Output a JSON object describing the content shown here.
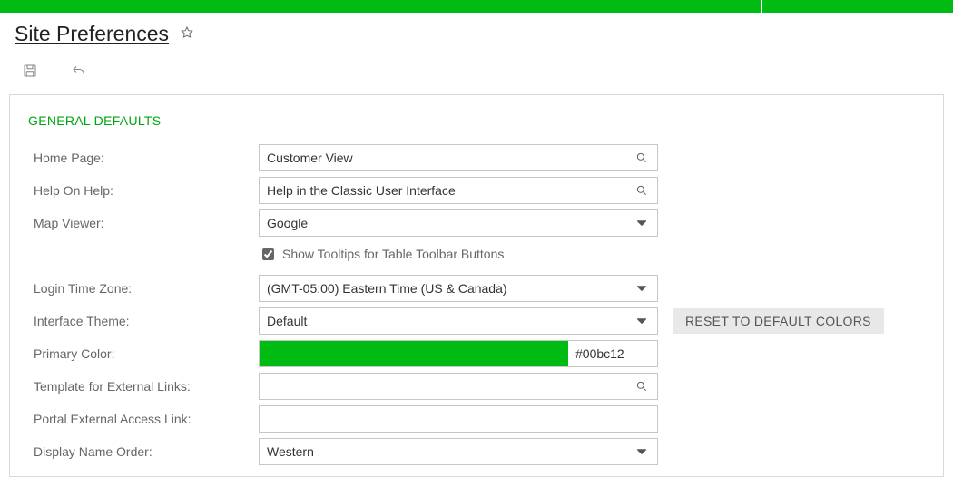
{
  "page": {
    "title": "Site Preferences"
  },
  "section": {
    "title": "GENERAL DEFAULTS"
  },
  "fields": {
    "home_page": {
      "label": "Home Page:",
      "value": "Customer View"
    },
    "help_on_help": {
      "label": "Help On Help:",
      "value": "Help in the Classic User Interface"
    },
    "map_viewer": {
      "label": "Map Viewer:",
      "value": "Google"
    },
    "show_tooltips": {
      "label": "Show Tooltips for Table Toolbar Buttons",
      "checked": true
    },
    "login_tz": {
      "label": "Login Time Zone:",
      "value": "(GMT-05:00) Eastern Time (US & Canada)"
    },
    "interface_theme": {
      "label": "Interface Theme:",
      "value": "Default",
      "reset_label": "RESET TO DEFAULT COLORS"
    },
    "primary_color": {
      "label": "Primary Color:",
      "value": "#00bc12"
    },
    "template_ext": {
      "label": "Template for External Links:",
      "value": ""
    },
    "portal_ext": {
      "label": "Portal External Access Link:",
      "value": ""
    },
    "display_name": {
      "label": "Display Name Order:",
      "value": "Western"
    }
  },
  "colors": {
    "accent": "#00bc12"
  }
}
